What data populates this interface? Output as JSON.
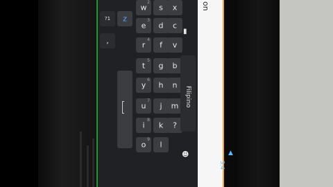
{
  "keyboard": {
    "language_label": "Filipino",
    "rows": [
      [
        {
          "ch": "w",
          "hint": "2"
        },
        {
          "ch": "s"
        },
        {
          "ch": "x"
        }
      ],
      [
        {
          "ch": "e",
          "hint": "3"
        },
        {
          "ch": "d"
        },
        {
          "ch": "c"
        }
      ],
      [
        {
          "ch": "r",
          "hint": "4"
        },
        {
          "ch": "f"
        },
        {
          "ch": "v"
        }
      ],
      [
        {
          "ch": "t",
          "hint": "5"
        },
        {
          "ch": "g"
        },
        {
          "ch": "b"
        }
      ],
      [
        {
          "ch": "y",
          "hint": "6"
        },
        {
          "ch": "h"
        },
        {
          "ch": "n"
        }
      ],
      [
        {
          "ch": "u",
          "hint": "7"
        },
        {
          "ch": "j"
        },
        {
          "ch": "m"
        }
      ],
      [
        {
          "ch": "i",
          "hint": "8"
        },
        {
          "ch": "k"
        },
        {
          "ch": "?"
        }
      ],
      [
        {
          "ch": "o",
          "hint": "9"
        },
        {
          "ch": "l"
        }
      ]
    ],
    "leftcol": {
      "z": "z",
      "sym": "?1",
      "comma": ","
    },
    "emoji": "☻",
    "mic": "🎙"
  },
  "app": {
    "title_fragment": "on"
  },
  "status": {
    "clock": "3:4",
    "signal_icon": "signal-icon"
  }
}
